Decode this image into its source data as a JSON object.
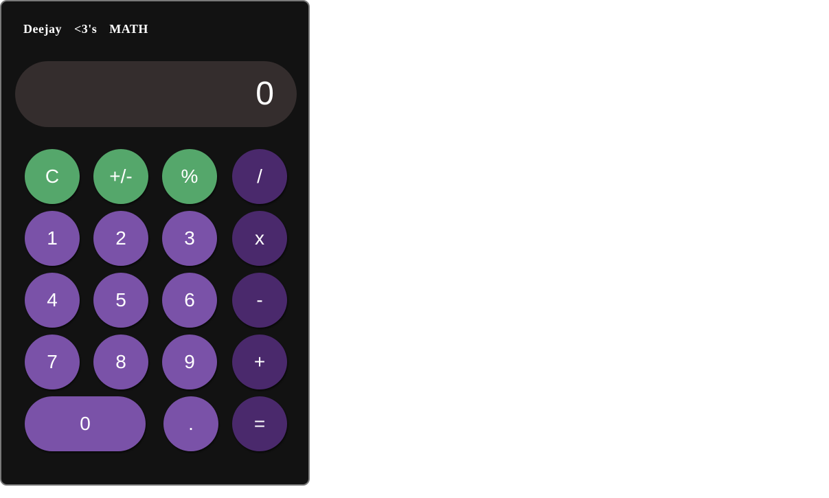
{
  "app": {
    "title": "Deejay  <3's  MATH"
  },
  "display": {
    "value": "0"
  },
  "colors": {
    "function": "#55a76b",
    "number": "#7a52a8",
    "operator": "#4a296c",
    "display_bg": "#342d2d",
    "body_bg": "#121212"
  },
  "buttons": {
    "clear": "C",
    "negate": "+/-",
    "percent": "%",
    "divide": "/",
    "one": "1",
    "two": "2",
    "three": "3",
    "multiply": "x",
    "four": "4",
    "five": "5",
    "six": "6",
    "subtract": "-",
    "seven": "7",
    "eight": "8",
    "nine": "9",
    "add": "+",
    "zero": "0",
    "decimal": ".",
    "equals": "="
  }
}
